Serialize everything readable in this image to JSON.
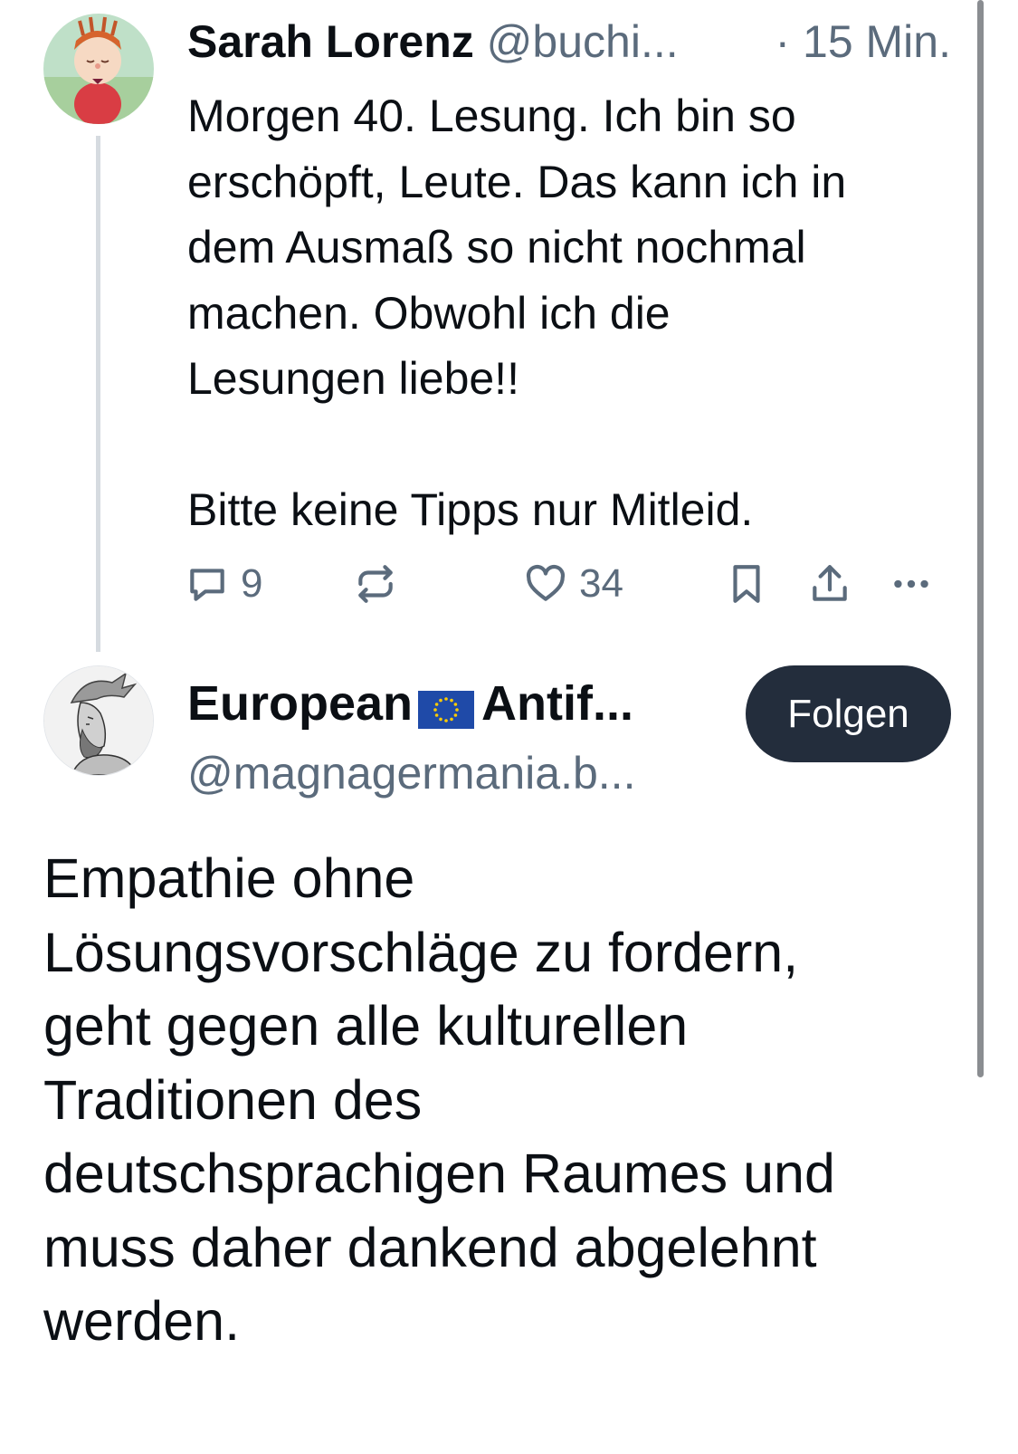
{
  "thread": {
    "post1": {
      "author_name": "Sarah Lorenz",
      "handle": "@buchi...",
      "time": "· 15 Min.",
      "text": "Morgen 40. Lesung. Ich bin so\nerschöpft, Leute. Das kann ich in\ndem Ausmaß so nicht nochmal\nmachen. Obwohl ich die\nLesungen liebe!!\n\nBitte keine Tipps nur Mitleid.",
      "actions": {
        "reply_count": "9",
        "like_count": "34",
        "icons": [
          "reply-icon",
          "repost-icon",
          "like-icon",
          "bookmark-icon",
          "share-icon",
          "more-icon"
        ]
      }
    },
    "post2": {
      "author_name_part1": "European",
      "author_name_part2": "Antif...",
      "handle": "@magnagermania.b...",
      "follow_label": "Folgen",
      "text": "Empathie ohne\nLösungsvorschläge zu fordern,\ngeht gegen alle kulturellen\nTraditionen des\ndeutschsprachigen Raumes und\nmuss daher dankend abgelehnt\nwerden."
    }
  },
  "colors": {
    "text": "#0b0f14",
    "muted": "#5b6b7c",
    "thread_line": "#d6dbe0",
    "follow_button_bg": "#232d3c",
    "eu_flag_blue": "#1f4aa8",
    "eu_flag_stars": "#ffcc00"
  }
}
